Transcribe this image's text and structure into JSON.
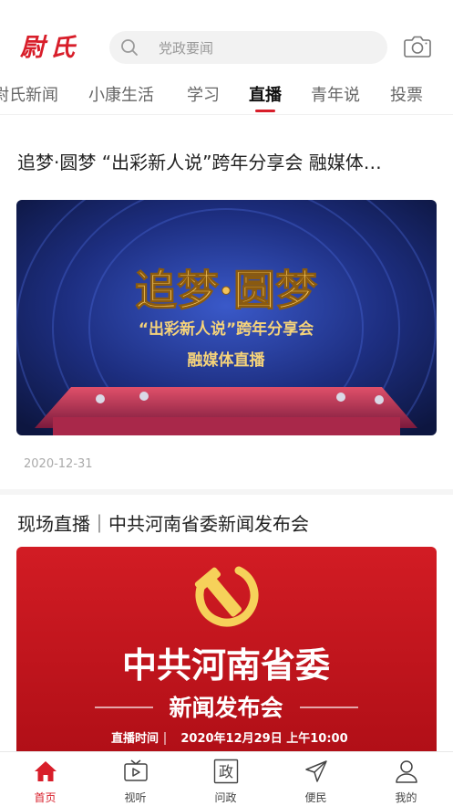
{
  "header": {
    "logo_text": "尉氏",
    "search_placeholder": "党政要闻"
  },
  "tabs": [
    {
      "label": "尉氏新闻"
    },
    {
      "label": "小康生活"
    },
    {
      "label": "学习"
    },
    {
      "label": "直播"
    },
    {
      "label": "青年说"
    },
    {
      "label": "投票"
    }
  ],
  "active_tab": "直播",
  "articles": [
    {
      "title": "追梦·圆梦 “出彩新人说”跨年分享会 融媒体…",
      "banner": {
        "headline": "追梦·圆梦",
        "subline": "“出彩新人说”跨年分享会",
        "tag": "融媒体直播"
      },
      "date": "2020-12-31"
    },
    {
      "title": "现场直播｜中共河南省委新闻发布会",
      "banner": {
        "headline": "中共河南省委",
        "subline": "新闻发布会",
        "time_label": "直播时间",
        "time_value": "2020年12月29日 上午10:00"
      }
    }
  ],
  "bottom_nav": [
    {
      "label": "首页",
      "icon": "home-icon"
    },
    {
      "label": "视听",
      "icon": "tv-icon"
    },
    {
      "label": "问政",
      "icon": "zheng-icon",
      "glyph": "政"
    },
    {
      "label": "便民",
      "icon": "send-icon"
    },
    {
      "label": "我的",
      "icon": "user-icon"
    }
  ],
  "colors": {
    "accent": "#d81e2a",
    "banner1_bg": "#1b2a6b",
    "banner1_gold": "#f3c35a",
    "banner2_bg": "#c8141c"
  }
}
